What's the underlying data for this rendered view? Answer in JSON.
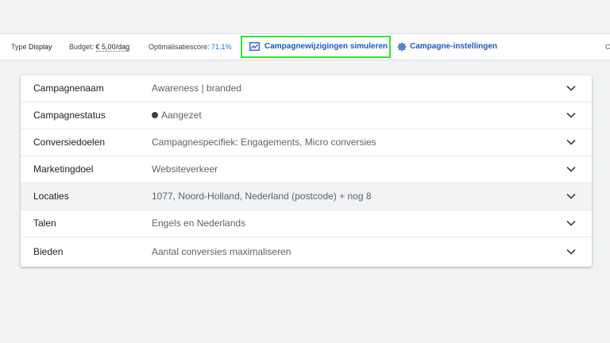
{
  "toolbar": {
    "type_label": "Type",
    "type_value": "Display",
    "budget_label": "Budget:",
    "budget_value": "€ 5,00/dag",
    "score_label": "Optimalisatiescore:",
    "score_value": "71,1%",
    "simulate_label": "Campagnewijzigingen simuleren",
    "settings_label": "Campagne-instellingen",
    "truncated_text": "C"
  },
  "settings": {
    "rows": [
      {
        "label": "Campagnenaam",
        "value": "Awareness | branded"
      },
      {
        "label": "Campagnestatus",
        "value": "Aangezet",
        "status_color": "#3c4043"
      },
      {
        "label": "Conversiedoelen",
        "value": "Campagnespecifiek: Engagements, Micro conversies"
      },
      {
        "label": "Marketingdoel",
        "value": "Websiteverkeer"
      },
      {
        "label": "Locaties",
        "value": "1077, Noord-Holland, Nederland (postcode) + nog 8"
      },
      {
        "label": "Talen",
        "value": "Engels en Nederlands"
      },
      {
        "label": "Bieden",
        "value": "Aantal conversies maximaliseren"
      }
    ]
  },
  "colors": {
    "accent": "#1a57c2",
    "highlight_border": "#2ee82e",
    "hover_row": "#f1f3f4"
  },
  "icons": {
    "simulate": "line-chart-icon",
    "settings": "gear-icon",
    "expand": "chevron-down-icon"
  }
}
